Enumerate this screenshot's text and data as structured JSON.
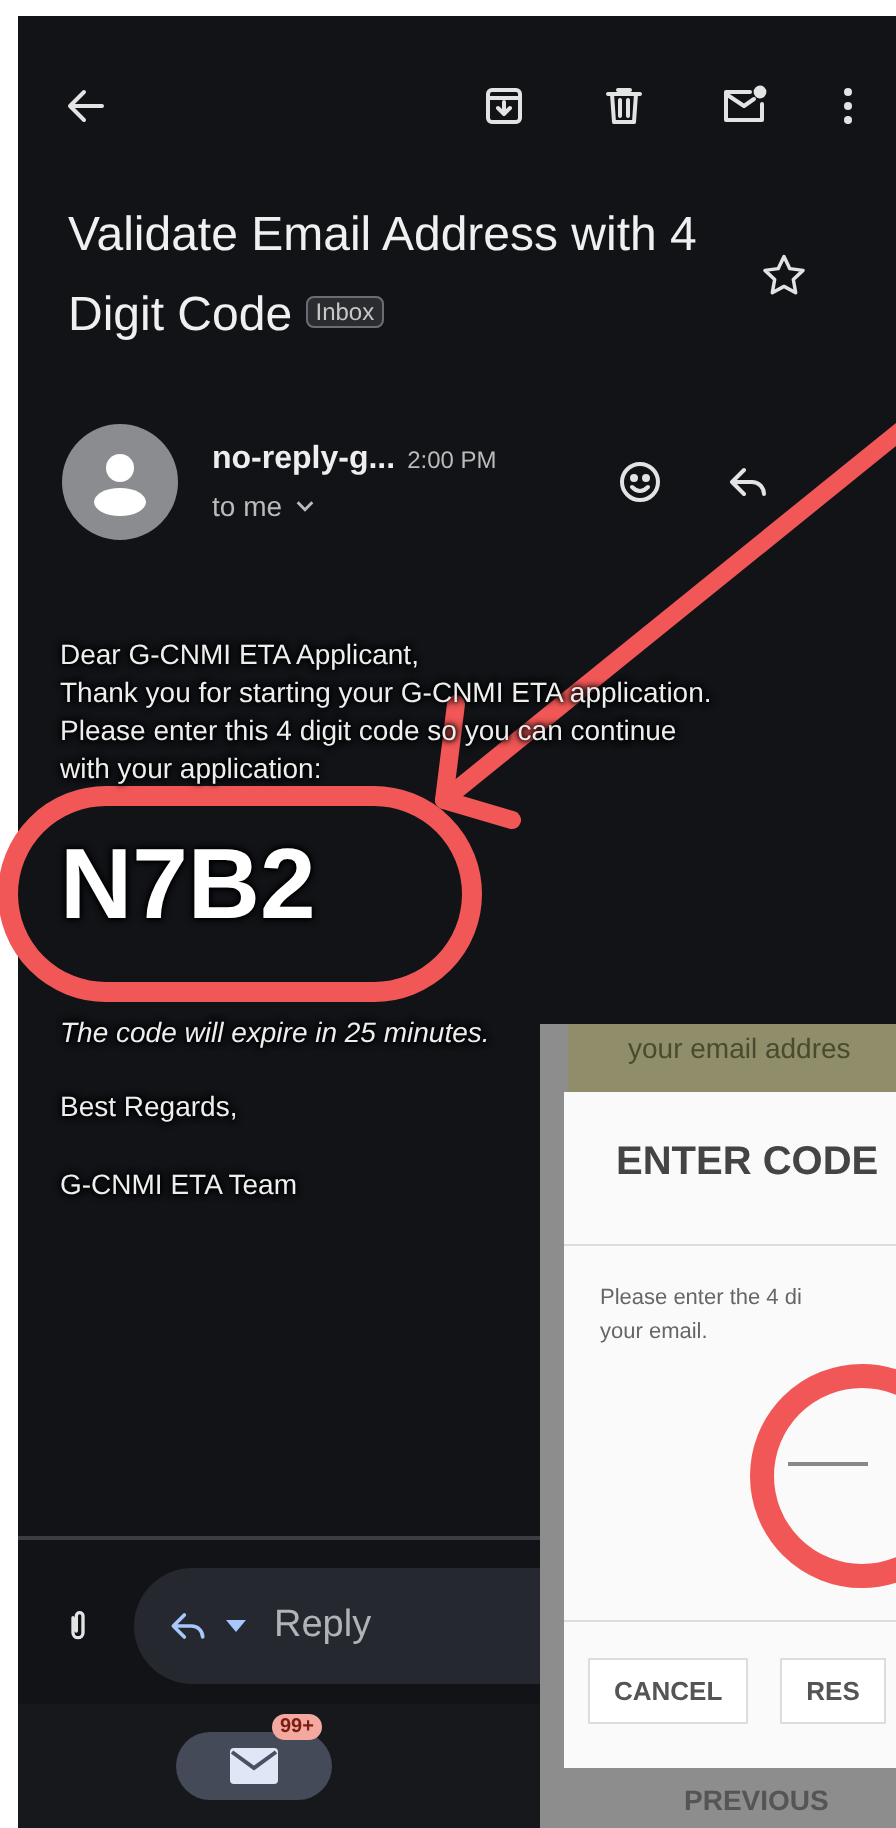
{
  "email": {
    "subject": "Validate Email Address with 4 Digit Code",
    "label": "Inbox",
    "starred": false,
    "sender": "no-reply-g...",
    "time": "2:00 PM",
    "recipient": "to me",
    "greeting": "Dear G-CNMI ETA Applicant,",
    "message": "Thank you for starting your G-CNMI ETA application.\nPlease enter this 4 digit code so you can continue\nwith your application:",
    "code": "N7B2",
    "expiry": "The code will expire in 25 minutes.",
    "closing": "Best Regards,",
    "signature": "G-CNMI ETA Team"
  },
  "reply_bar": {
    "placeholder": "Reply"
  },
  "bottom_nav": {
    "badge": "99+"
  },
  "inset": {
    "banner": "your email addres",
    "dialog_title": "ENTER CODE",
    "dialog_message": "Please enter the 4 di\nyour email.",
    "buttons": [
      "CANCEL",
      "RES"
    ],
    "footer": "PREVIOUS"
  }
}
